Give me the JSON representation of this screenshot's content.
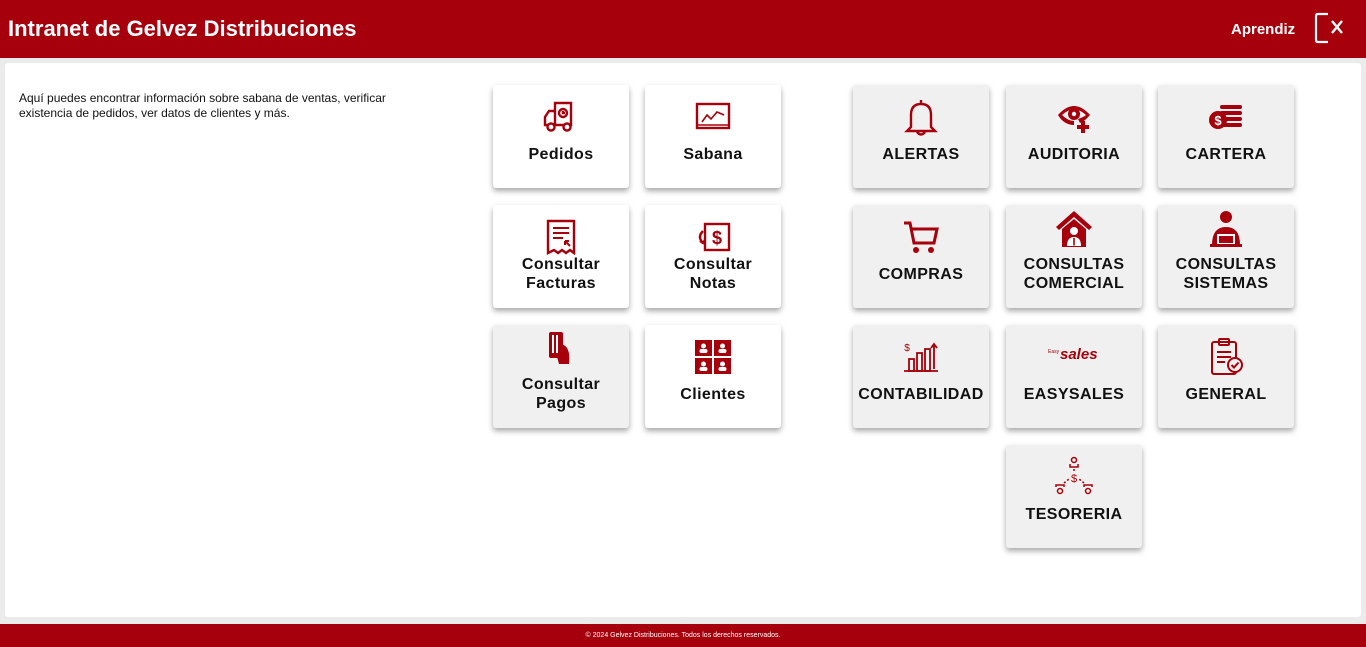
{
  "header": {
    "title": "Intranet de Gelvez Distribuciones",
    "user": "Aprendiz",
    "logout_icon": "logout-icon"
  },
  "main": {
    "description": "Aquí puedes encontrar información sobre sabana de ventas, verificar existencia de pedidos, ver datos de clientes y más."
  },
  "left_tiles": [
    {
      "label": "Pedidos",
      "icon": "truck-icon"
    },
    {
      "label": "Sabana",
      "icon": "chart-icon"
    },
    {
      "label_l1": "Consultar",
      "label_l2": "Facturas",
      "icon": "invoice-icon"
    },
    {
      "label_l1": "Consultar",
      "label_l2": "Notas",
      "icon": "money-note-icon"
    },
    {
      "label_l1": "Consultar",
      "label_l2": "Pagos",
      "icon": "card-payment-icon"
    },
    {
      "label": "Clientes",
      "icon": "clients-grid-icon"
    }
  ],
  "right_tiles": [
    {
      "label": "ALERTAS",
      "icon": "bell-icon"
    },
    {
      "label": "AUDITORIA",
      "icon": "eye-plus-icon"
    },
    {
      "label": "CARTERA",
      "icon": "coins-icon"
    },
    {
      "label": "COMPRAS",
      "icon": "cart-icon"
    },
    {
      "label_l1": "CONSULTAS",
      "label_l2": "COMERCIAL",
      "icon": "house-person-icon"
    },
    {
      "label_l1": "CONSULTAS",
      "label_l2": "SISTEMAS",
      "icon": "person-laptop-icon"
    },
    {
      "label": "CONTABILIDAD",
      "icon": "bar-chart-icon"
    },
    {
      "label": "EASYSALES",
      "icon": "easysales-logo"
    },
    {
      "label": "GENERAL",
      "icon": "clipboard-check-icon"
    },
    {
      "label": "TESORERIA",
      "icon": "money-flow-icon"
    }
  ],
  "easysales_logo": {
    "small": "Easy",
    "big": "sales"
  },
  "footer": {
    "text": "© 2024 Gelvez Distribuciones. Todos los derechos reservados."
  },
  "colors": {
    "brand": "#a5000c",
    "tile_gray": "#f0f0f0"
  }
}
